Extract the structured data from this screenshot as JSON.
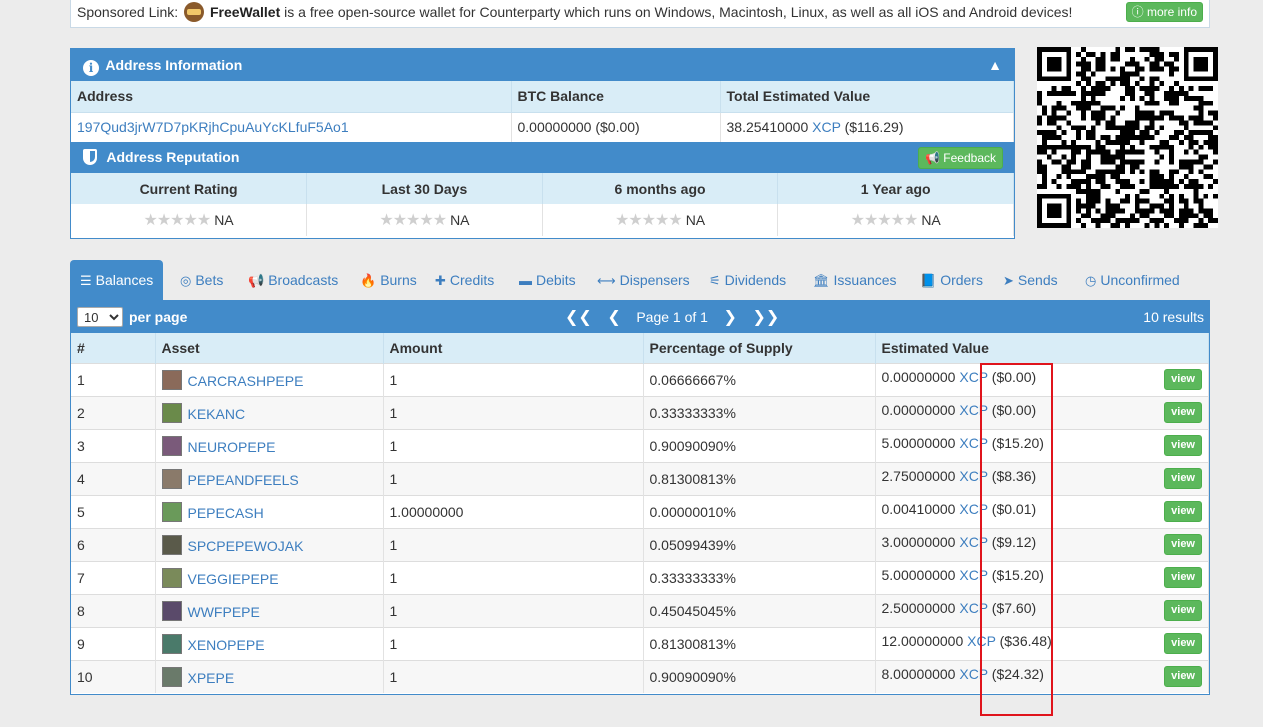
{
  "sponsor": {
    "prefix": "Sponsored Link:",
    "brand": "FreeWallet",
    "text": "is a free open-source wallet for Counterparty which runs on Windows, Macintosh, Linux, as well as all iOS and Android devices!",
    "button": "more info",
    "icon": "wallet-icon"
  },
  "address_panel": {
    "title": "Address Information",
    "headers": [
      "Address",
      "BTC Balance",
      "Total Estimated Value"
    ],
    "address": "197Qud3jrW7D7pKRjhCpuAuYcKLfuF5Ao1",
    "btc_balance": "0.00000000 ($0.00)",
    "total_value_amount": "38.25410000",
    "total_value_asset": "XCP",
    "total_value_usd": "($116.29)"
  },
  "reputation": {
    "title": "Address Reputation",
    "feedback_button": "Feedback",
    "headers": [
      "Current Rating",
      "Last 30 Days",
      "6 months ago",
      "1 Year ago"
    ],
    "values": [
      "NA",
      "NA",
      "NA",
      "NA"
    ]
  },
  "tabs": [
    {
      "label": "Balances",
      "icon": "list-icon"
    },
    {
      "label": "Bets",
      "icon": "target-icon"
    },
    {
      "label": "Broadcasts",
      "icon": "megaphone-icon"
    },
    {
      "label": "Burns",
      "icon": "fire-icon"
    },
    {
      "label": "Credits",
      "icon": "plus-icon"
    },
    {
      "label": "Debits",
      "icon": "minus-icon"
    },
    {
      "label": "Dispensers",
      "icon": "arrows-icon"
    },
    {
      "label": "Dividends",
      "icon": "sitemap-icon"
    },
    {
      "label": "Issuances",
      "icon": "bank-icon"
    },
    {
      "label": "Orders",
      "icon": "book-icon"
    },
    {
      "label": "Sends",
      "icon": "paper-plane-icon"
    },
    {
      "label": "Unconfirmed",
      "icon": "clock-icon"
    }
  ],
  "balances": {
    "per_page_value": "10",
    "per_page_label": "per page",
    "page_label": "Page 1 of 1",
    "results": "10 results",
    "columns": [
      "#",
      "Asset",
      "Amount",
      "Percentage of Supply",
      "Estimated Value"
    ],
    "view_label": "view",
    "rows": [
      {
        "n": "1",
        "asset": "CARCRASHPEPE",
        "amount": "1",
        "pct": "0.06666667%",
        "val": "0.00000000",
        "unit": "XCP",
        "usd": "($0.00)"
      },
      {
        "n": "2",
        "asset": "KEKANC",
        "amount": "1",
        "pct": "0.33333333%",
        "val": "0.00000000",
        "unit": "XCP",
        "usd": "($0.00)"
      },
      {
        "n": "3",
        "asset": "NEUROPEPE",
        "amount": "1",
        "pct": "0.90090090%",
        "val": "5.00000000",
        "unit": "XCP",
        "usd": "($15.20)"
      },
      {
        "n": "4",
        "asset": "PEPEANDFEELS",
        "amount": "1",
        "pct": "0.81300813%",
        "val": "2.75000000",
        "unit": "XCP",
        "usd": "($8.36)"
      },
      {
        "n": "5",
        "asset": "PEPECASH",
        "amount": "1.00000000",
        "pct": "0.00000010%",
        "val": "0.00410000",
        "unit": "XCP",
        "usd": "($0.01)"
      },
      {
        "n": "6",
        "asset": "SPCPEPEWOJAK",
        "amount": "1",
        "pct": "0.05099439%",
        "val": "3.00000000",
        "unit": "XCP",
        "usd": "($9.12)"
      },
      {
        "n": "7",
        "asset": "VEGGIEPEPE",
        "amount": "1",
        "pct": "0.33333333%",
        "val": "5.00000000",
        "unit": "XCP",
        "usd": "($15.20)"
      },
      {
        "n": "8",
        "asset": "WWFPEPE",
        "amount": "1",
        "pct": "0.45045045%",
        "val": "2.50000000",
        "unit": "XCP",
        "usd": "($7.60)"
      },
      {
        "n": "9",
        "asset": "XENOPEPE",
        "amount": "1",
        "pct": "0.81300813%",
        "val": "12.00000000",
        "unit": "XCP",
        "usd": "($36.48)"
      },
      {
        "n": "10",
        "asset": "XPEPE",
        "amount": "1",
        "pct": "0.90090090%",
        "val": "8.00000000",
        "unit": "XCP",
        "usd": "($24.32)"
      }
    ]
  },
  "colors": {
    "primary": "#428bca",
    "header_bg": "#d9edf7",
    "success": "#5cb85c",
    "link": "#3d7ebf",
    "highlight_box": "#e0141c"
  }
}
